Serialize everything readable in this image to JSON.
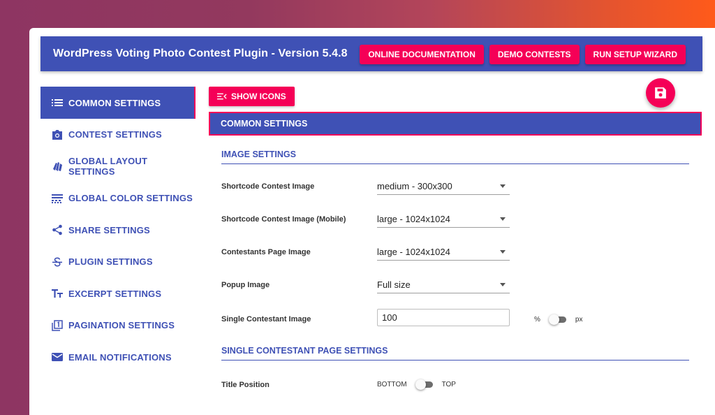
{
  "header": {
    "title": "WordPress Voting Photo Contest Plugin - Version 5.4.8",
    "buttons": [
      "ONLINE DOCUMENTATION",
      "DEMO CONTESTS",
      "RUN SETUP WIZARD"
    ]
  },
  "sidebar": {
    "items": [
      {
        "label": "COMMON SETTINGS",
        "icon": "list-icon",
        "active": true
      },
      {
        "label": "CONTEST SETTINGS",
        "icon": "camera-icon",
        "active": false
      },
      {
        "label": "GLOBAL LAYOUT SETTINGS",
        "icon": "layers-icon",
        "active": false
      },
      {
        "label": "GLOBAL COLOR SETTINGS",
        "icon": "texture-icon",
        "active": false
      },
      {
        "label": "SHARE SETTINGS",
        "icon": "share-icon",
        "active": false
      },
      {
        "label": "PLUGIN SETTINGS",
        "icon": "strikethrough-icon",
        "active": false
      },
      {
        "label": "EXCERPT SETTINGS",
        "icon": "text-fields-icon",
        "active": false
      },
      {
        "label": "PAGINATION SETTINGS",
        "icon": "filter-1-icon",
        "active": false
      },
      {
        "label": "EMAIL NOTIFICATIONS",
        "icon": "mail-icon",
        "active": false
      }
    ]
  },
  "toolbar": {
    "show_icons_label": "SHOW ICONS",
    "save_icon": "save-icon"
  },
  "main": {
    "section_title": "COMMON SETTINGS",
    "image_settings": {
      "heading": "IMAGE SETTINGS",
      "rows": [
        {
          "label": "Shortcode Contest Image",
          "value": "medium - 300x300"
        },
        {
          "label": "Shortcode Contest Image (Mobile)",
          "value": "large - 1024x1024"
        },
        {
          "label": "Contestants Page Image",
          "value": "large - 1024x1024"
        },
        {
          "label": "Popup Image",
          "value": "Full size"
        }
      ],
      "single_image": {
        "label": "Single Contestant Image",
        "value": "100",
        "unit_left": "%",
        "unit_right": "px"
      }
    },
    "single_page_settings": {
      "heading": "SINGLE CONTESTANT PAGE SETTINGS",
      "title_position": {
        "label": "Title Position",
        "left": "BOTTOM",
        "right": "TOP"
      }
    }
  },
  "colors": {
    "primary": "#3f51b5",
    "accent": "#f50057"
  }
}
